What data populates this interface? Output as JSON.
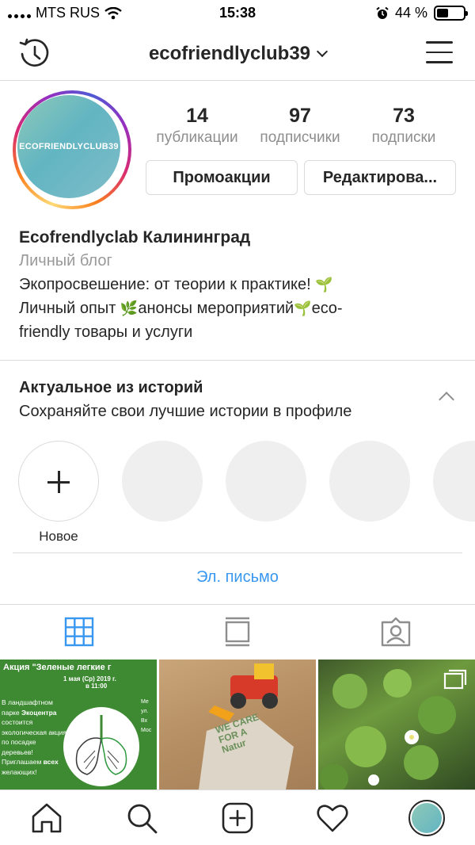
{
  "status_bar": {
    "carrier": "MTS RUS",
    "time": "15:38",
    "battery": "44 %",
    "battery_level": 0.44
  },
  "header": {
    "username": "ecofriendlyclub39"
  },
  "profile": {
    "avatar_text": "ECOFRIENDLYCLUB39",
    "stats": [
      {
        "value": "14",
        "label": "публикации"
      },
      {
        "value": "97",
        "label": "подписчики"
      },
      {
        "value": "73",
        "label": "подписки"
      }
    ],
    "buttons": {
      "promo": "Промоакции",
      "edit": "Редактирова..."
    },
    "name": "Ecofrendlyclab Калининград",
    "category": "Личный блог",
    "bio_line1": "Экопросвешение: от теории к практике!",
    "bio_line2a": "Личный опыт",
    "bio_line2b": "анонсы мероприятий",
    "bio_line2c": "eco-",
    "bio_line3": "friendly товары и услуги"
  },
  "highlights": {
    "title": "Актуальное из историй",
    "subtitle": "Сохраняйте свои лучшие истории в профиле",
    "new_label": "Новое"
  },
  "email_link": "Эл. письмо",
  "grid": {
    "post1": {
      "title": "Акция \"Зеленые легкие г",
      "date": "1 мая (Ср) 2019 г.",
      "time": "в 11:00",
      "body": "В ландшафтном парке Экоцентра состоится экологическая акция по посадке деревьев! Приглашаем всех желающих!",
      "side": "Ме\nул.\nВх\nМос"
    },
    "post2": {
      "text": "WE CARE FOR A Natur"
    }
  },
  "icons": {
    "history": "history-icon",
    "menu": "menu-icon",
    "grid": "grid-icon",
    "feed": "feed-icon",
    "tagged": "tagged-icon",
    "home": "home-icon",
    "search": "search-icon",
    "add": "add-post-icon",
    "activity": "heart-icon",
    "profile": "profile-avatar-icon",
    "carousel": "carousel-icon"
  },
  "colors": {
    "link": "#3897f0",
    "active_tab": "#3897f0",
    "border": "#dbdbdb",
    "muted": "#8e8e8e"
  }
}
